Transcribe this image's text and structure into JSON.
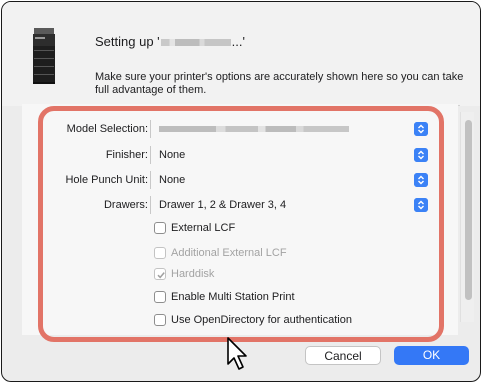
{
  "colors": {
    "accent": "#3478f6",
    "highlight_border": "#e27467",
    "window_border": "#1a1a1a"
  },
  "header": {
    "icon": "printer-icon",
    "title_prefix": "Setting up '",
    "title_suffix": "...'",
    "subtitle": "Make sure your printer's options are accurately shown here so you can take full advantage of them."
  },
  "options": {
    "model_selection": {
      "label": "Model Selection:"
    },
    "finisher": {
      "label": "Finisher:",
      "value": "None"
    },
    "hole_punch": {
      "label": "Hole Punch Unit:",
      "value": "None"
    },
    "drawers": {
      "label": "Drawers:",
      "value": "Drawer 1, 2 & Drawer 3, 4"
    }
  },
  "checkboxes": [
    {
      "label": "External LCF",
      "checked": false,
      "disabled": false
    },
    {
      "label": "Additional External LCF",
      "checked": false,
      "disabled": true
    },
    {
      "label": "Harddisk",
      "checked": true,
      "disabled": true
    },
    {
      "label": "Enable Multi Station Print",
      "checked": false,
      "disabled": false
    },
    {
      "label": "Use OpenDirectory for authentication",
      "checked": false,
      "disabled": false
    }
  ],
  "buttons": {
    "cancel": "Cancel",
    "ok": "OK"
  }
}
